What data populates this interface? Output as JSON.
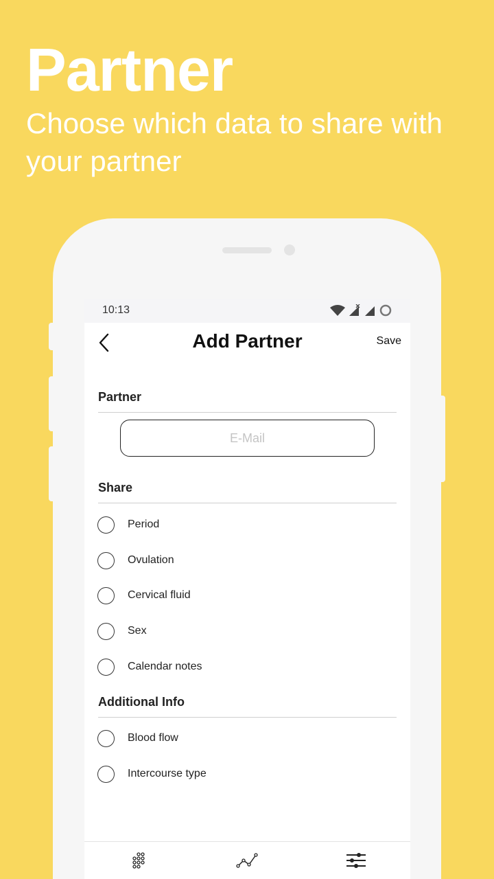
{
  "promo": {
    "title": "Partner",
    "subtitle": "Choose which data to share with your partner"
  },
  "status_bar": {
    "time": "10:13",
    "icons": [
      "wifi-icon",
      "signal-no-data-icon",
      "signal-icon",
      "battery-icon"
    ]
  },
  "header": {
    "title": "Add Partner",
    "save_label": "Save",
    "back_icon": "chevron-left-icon"
  },
  "partner_section": {
    "label": "Partner",
    "email_placeholder": "E-Mail",
    "email_value": ""
  },
  "share_section": {
    "label": "Share",
    "options": [
      {
        "label": "Period",
        "checked": false
      },
      {
        "label": "Ovulation",
        "checked": false
      },
      {
        "label": "Cervical fluid",
        "checked": false
      },
      {
        "label": "Sex",
        "checked": false
      },
      {
        "label": "Calendar notes",
        "checked": false
      }
    ]
  },
  "additional_section": {
    "label": "Additional Info",
    "options": [
      {
        "label": "Blood flow",
        "checked": false
      },
      {
        "label": "Intercourse type",
        "checked": false
      }
    ]
  },
  "tab_bar": {
    "tabs": [
      {
        "icon": "calendar-dots-icon"
      },
      {
        "icon": "chart-line-icon"
      },
      {
        "icon": "settings-sliders-icon"
      }
    ]
  },
  "colors": {
    "background": "#f9d85e",
    "phone": "#f6f6f6",
    "text": "#222222"
  }
}
